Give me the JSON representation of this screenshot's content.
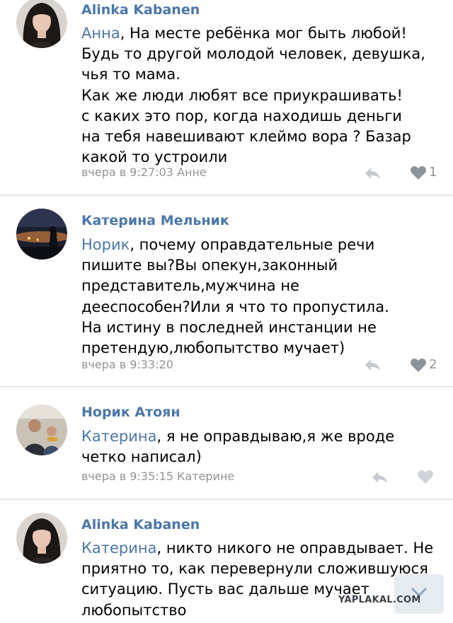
{
  "comments": [
    {
      "author": "Alinka Kabanen",
      "mention": "Анна",
      "lines": [
        ", На месте ребёнка мог быть любой!",
        "Будь то другой молодой человек, девушка,",
        "чья то мама.",
        "Как же люди любят все приукрашивать!",
        "с каких это пор, когда находишь деньги",
        "на тебя навешивают клеймо вора ? Базар",
        "какой то устроили"
      ],
      "meta": "вчера в 9:27:03 Анне",
      "likes": "1",
      "liked": true
    },
    {
      "author": "Катерина Мельник",
      "mention": "Норик",
      "lines": [
        ",  почему оправдательные речи",
        "пишите вы?Вы опекун,законный",
        "представитель,мужчина не",
        "дееспособен?Или я что то пропустила.",
        "На истину в последней инстанции не",
        "претендую,любопытство мучает)"
      ],
      "meta": "вчера в 9:33:20",
      "likes": "2",
      "liked": true
    },
    {
      "author": "Норик Атоян",
      "mention": "Катерина",
      "lines": [
        ", я не оправдываю,я же вроде",
        "четко написал)"
      ],
      "meta": "вчера в 9:35:15 Катерине",
      "likes": "",
      "liked": false
    },
    {
      "author": "Alinka Kabanen",
      "mention": "Катерина",
      "lines": [
        ", никто никого не оправдывает. Не",
        "приятно то, как перевернули сложившуюся",
        "ситуацию. Пусть вас дальше мучает",
        "любопытство"
      ],
      "meta": "",
      "likes": "",
      "liked": false
    }
  ],
  "watermark": "YAPLAKAL.COM",
  "icons": {
    "reply": "reply-arrow-icon",
    "like": "heart-icon",
    "scroll": "chevron-down-icon"
  },
  "colors": {
    "link": "#4a76a8",
    "meta": "#939393",
    "like_active": "#8d9399",
    "like_inactive": "#cfd3d7",
    "divider": "#e4e6ea"
  }
}
